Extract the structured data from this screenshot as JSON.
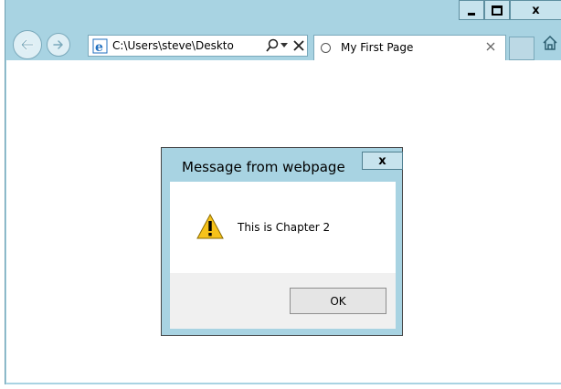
{
  "window": {
    "caption_buttons": {
      "minimize_icon": "minimize-icon",
      "maximize_icon": "maximize-icon",
      "close_label": "x"
    }
  },
  "toolbar": {
    "back_icon": "back-arrow-icon",
    "forward_icon": "forward-arrow-icon",
    "address": {
      "page_icon": "ie-page-icon",
      "url": "C:\\Users\\steve\\Deskto",
      "search_icon": "search-icon",
      "dropdown_icon": "chevron-down-icon",
      "stop_icon": "close-icon"
    },
    "tab": {
      "loading_icon": "loading-icon",
      "title": "My First Page",
      "close_icon": "close-icon"
    },
    "home_icon": "home-icon"
  },
  "dialog": {
    "title": "Message from webpage",
    "close_label": "x",
    "icon": "warning-icon",
    "message": "This is Chapter 2",
    "ok_label": "OK"
  },
  "colors": {
    "chrome": "#a8d3e2",
    "dialog_border": "#474747",
    "footer": "#f0f0f0"
  }
}
